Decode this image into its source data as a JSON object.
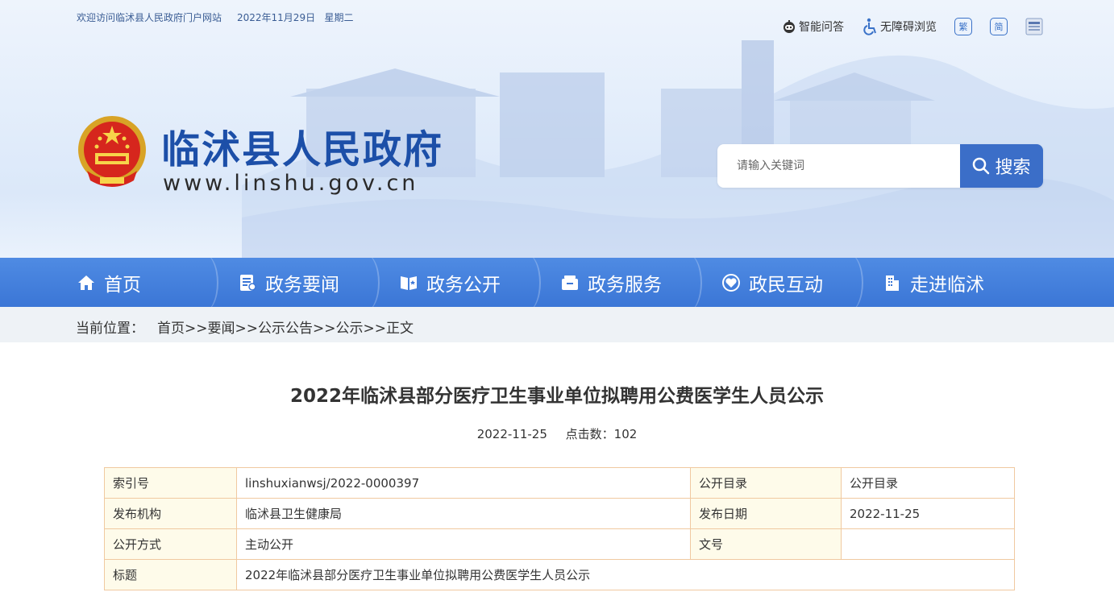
{
  "topbar": {
    "welcome": "欢迎访问临沭县人民政府门户网站",
    "date": "2022年11月29日   星期二",
    "tools": {
      "smart_qa": "智能问答",
      "accessibility": "无障碍浏览",
      "traditional": "繁",
      "simplified": "简"
    }
  },
  "site": {
    "title": "临沭县人民政府",
    "url": "www.linshu.gov.cn"
  },
  "search": {
    "placeholder": "请输入关键词",
    "button": "搜索"
  },
  "nav": {
    "items": [
      {
        "label": "首页",
        "icon": "home-icon"
      },
      {
        "label": "政务要闻",
        "icon": "news-icon"
      },
      {
        "label": "政务公开",
        "icon": "open-book-icon"
      },
      {
        "label": "政务服务",
        "icon": "service-box-icon"
      },
      {
        "label": "政民互动",
        "icon": "interaction-heart-icon"
      },
      {
        "label": "走进临沭",
        "icon": "building-icon"
      }
    ]
  },
  "breadcrumb": {
    "label": "当前位置：",
    "path": "首页>>要闻>>公示公告>>公示>>正文"
  },
  "article": {
    "title": "2022年临沭县部分医疗卫生事业单位拟聘用公费医学生人员公示",
    "date": "2022-11-25",
    "clicks": "点击数：102"
  },
  "info": {
    "index_label": "索引号",
    "index_value": "linshuxianwsj/2022-0000397",
    "catalog_label": "公开目录",
    "catalog_value": "公开目录",
    "org_label": "发布机构",
    "org_value": "临沭县卫生健康局",
    "pubdate_label": "发布日期",
    "pubdate_value": "2022-11-25",
    "mode_label": "公开方式",
    "mode_value": "主动公开",
    "docno_label": "文号",
    "docno_value": "",
    "title_label": "标题",
    "title_value": "2022年临沭县部分医疗卫生事业单位拟聘用公费医学生人员公示"
  },
  "colors": {
    "brand_blue": "#1c4fa8",
    "nav_blue": "#3b76d6",
    "search_blue": "#3b6ec8",
    "table_border": "#f0c9a0",
    "table_label_bg": "#fefbea"
  }
}
